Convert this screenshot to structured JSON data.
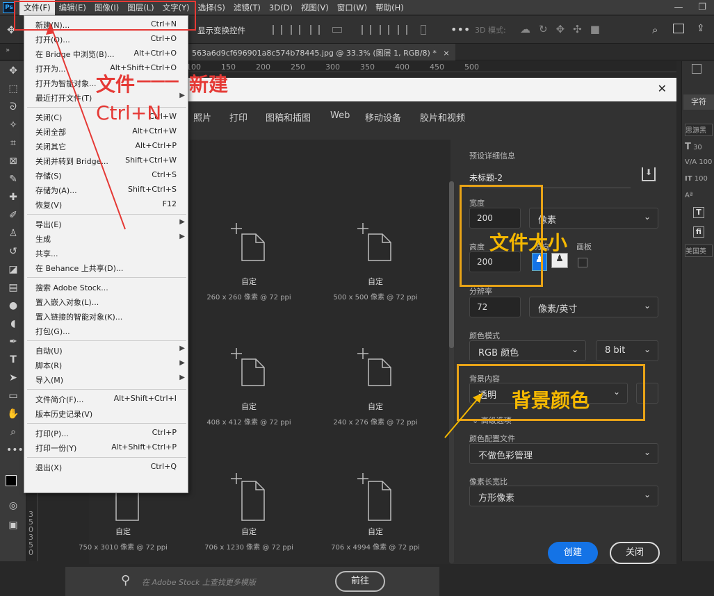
{
  "app": {
    "logo": "Ps"
  },
  "menubar": {
    "items": [
      "文件(F)",
      "编辑(E)",
      "图像(I)",
      "图层(L)",
      "文字(Y)",
      "选择(S)",
      "滤镜(T)",
      "3D(D)",
      "视图(V)",
      "窗口(W)",
      "帮助(H)"
    ]
  },
  "window_controls": {
    "minimize": "—",
    "restore": "❐"
  },
  "options_bar": {
    "show_transform": "显示变换控件",
    "mode_3d": "3D 模式:"
  },
  "doc_tab": {
    "title": "563a6d9cf696901a8c574b78445.jpg @ 33.3% (图层 1, RGB/8) *",
    "close": "×"
  },
  "ruler": {
    "ticks": [
      "150",
      "100",
      "50",
      "0",
      "50",
      "100",
      "150",
      "200",
      "250",
      "300",
      "350",
      "400",
      "450",
      "500"
    ],
    "left_ticks": [
      "3",
      "5",
      "0",
      "3",
      "5",
      "0"
    ]
  },
  "file_menu": {
    "groups": [
      [
        {
          "label": "新建(N)...",
          "shortcut": "Ctrl+N"
        },
        {
          "label": "打开(O)...",
          "shortcut": "Ctrl+O"
        },
        {
          "label": "在 Bridge 中浏览(B)...",
          "shortcut": "Alt+Ctrl+O"
        },
        {
          "label": "打开为...",
          "shortcut": "Alt+Shift+Ctrl+O"
        },
        {
          "label": "打开为智能对象...",
          "shortcut": ""
        },
        {
          "label": "最近打开文件(T)",
          "shortcut": "",
          "submenu": true
        }
      ],
      [
        {
          "label": "关闭(C)",
          "shortcut": "Ctrl+W"
        },
        {
          "label": "关闭全部",
          "shortcut": "Alt+Ctrl+W"
        },
        {
          "label": "关闭其它",
          "shortcut": "Alt+Ctrl+P"
        },
        {
          "label": "关闭并转到 Bridge...",
          "shortcut": "Shift+Ctrl+W"
        },
        {
          "label": "存储(S)",
          "shortcut": "Ctrl+S"
        },
        {
          "label": "存储为(A)...",
          "shortcut": "Shift+Ctrl+S"
        },
        {
          "label": "恢复(V)",
          "shortcut": "F12"
        }
      ],
      [
        {
          "label": "导出(E)",
          "shortcut": "",
          "submenu": true
        },
        {
          "label": "生成",
          "shortcut": "",
          "submenu": true
        },
        {
          "label": "共享...",
          "shortcut": ""
        },
        {
          "label": "在 Behance 上共享(D)...",
          "shortcut": ""
        }
      ],
      [
        {
          "label": "搜索 Adobe Stock...",
          "shortcut": ""
        },
        {
          "label": "置入嵌入对象(L)...",
          "shortcut": ""
        },
        {
          "label": "置入链接的智能对象(K)...",
          "shortcut": ""
        },
        {
          "label": "打包(G)...",
          "shortcut": ""
        }
      ],
      [
        {
          "label": "自动(U)",
          "shortcut": "",
          "submenu": true
        },
        {
          "label": "脚本(R)",
          "shortcut": "",
          "submenu": true
        },
        {
          "label": "导入(M)",
          "shortcut": "",
          "submenu": true
        }
      ],
      [
        {
          "label": "文件简介(F)...",
          "shortcut": "Alt+Shift+Ctrl+I"
        },
        {
          "label": "版本历史记录(V)",
          "shortcut": ""
        }
      ],
      [
        {
          "label": "打印(P)...",
          "shortcut": "Ctrl+P"
        },
        {
          "label": "打印一份(Y)",
          "shortcut": "Alt+Shift+Ctrl+P"
        }
      ],
      [
        {
          "label": "退出(X)",
          "shortcut": "Ctrl+Q"
        }
      ]
    ]
  },
  "dialog": {
    "close": "✕",
    "tabs": [
      "照片",
      "打印",
      "图稿和插图",
      "Web",
      "移动设备",
      "胶片和视频"
    ],
    "presets": [
      {
        "name": "自定",
        "dims": "260 x 260 像素 @ 72 ppi"
      },
      {
        "name": "自定",
        "dims": "500 x 500 像素 @ 72 ppi"
      },
      {
        "name": "自定",
        "dims": "408 x 412 像素 @ 72 ppi"
      },
      {
        "name": "自定",
        "dims": "240 x 276 像素 @ 72 ppi"
      },
      {
        "name": "自定",
        "dims": "750 x 3010 像素 @ 72 ppi"
      },
      {
        "name": "自定",
        "dims": "706 x 1230 像素 @ 72 ppi"
      },
      {
        "name": "自定",
        "dims": "706 x 4994 像素 @ 72 ppi"
      }
    ],
    "stock_search": {
      "placeholder": "在 Adobe Stock 上查找更多模版",
      "go": "前往"
    },
    "details": {
      "section": "预设详细信息",
      "doc_name": "未标题-2",
      "width_label": "宽度",
      "width_value": "200",
      "width_unit": "像素",
      "height_label": "高度",
      "height_value": "200",
      "orientation_label": "方向",
      "artboard_label": "画板",
      "resolution_label": "分辨率",
      "resolution_value": "72",
      "resolution_unit": "像素/英寸",
      "color_mode_label": "颜色模式",
      "color_mode": "RGB 颜色",
      "bit_depth": "8 bit",
      "bg_label": "背景内容",
      "bg_value": "透明",
      "advanced": "高级选项",
      "color_profile_label": "颜色配置文件",
      "color_profile": "不做色彩管理",
      "pixel_aspect_label": "像素长宽比",
      "pixel_aspect": "方形像素"
    },
    "create": "创建",
    "close_btn": "关闭"
  },
  "right_panel": {
    "tab": "字符",
    "font": "思源黑",
    "rows": [
      "30",
      "100",
      "100"
    ],
    "lang": "美国英"
  },
  "annotations": {
    "file_label": "文件",
    "new_label": "新建",
    "dash": "———",
    "shortcut": "Ctrl+N",
    "size_label": "文件大小",
    "bg_color_label": "背景颜色",
    "colors": {
      "yellow": "#e8a317",
      "red": "#e53935"
    }
  }
}
